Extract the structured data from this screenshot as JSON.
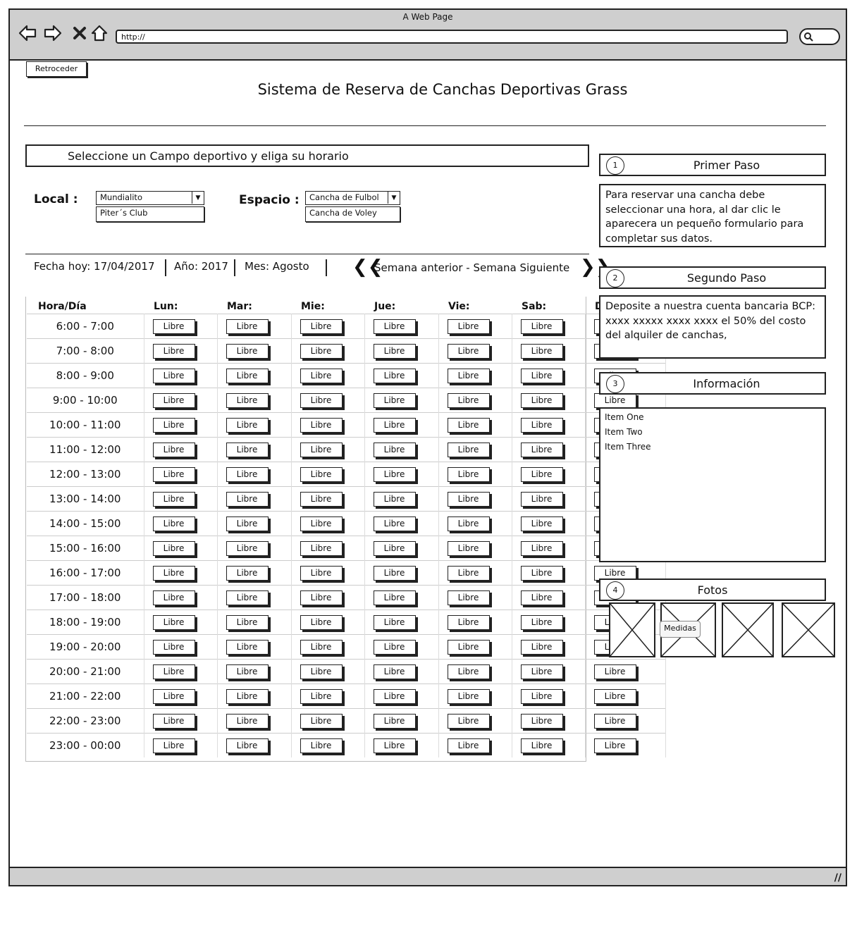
{
  "window": {
    "title": "A Web Page",
    "url": "http://"
  },
  "header": {
    "back_label": "Retroceder",
    "title": "Sistema de Reserva de Canchas Deportivas Grass"
  },
  "selector": {
    "heading": "Seleccione un Campo deportivo y eliga su horario",
    "local_label": "Local :",
    "local_selected": "Mundialito",
    "local_option": "Piter´s Club",
    "espacio_label": "Espacio :",
    "espacio_selected": "Cancha de Fulbol",
    "espacio_option": "Cancha de Voley"
  },
  "infobar": {
    "fecha": "Fecha hoy: 17/04/2017",
    "anio": "Año: 2017",
    "mes": "Mes: Agosto",
    "week_nav": "Semana anterior - Semana Siguiente"
  },
  "schedule": {
    "headers": [
      "Hora/Día",
      "Lun:",
      "Mar:",
      "Mie:",
      "Jue:",
      "Vie:",
      "Sab:",
      "Dom:"
    ],
    "slot_label": "Libre",
    "hours": [
      "6:00 - 7:00",
      "7:00 - 8:00",
      "8:00 - 9:00",
      "9:00 - 10:00",
      "10:00 - 11:00",
      "11:00 - 12:00",
      "12:00 - 13:00",
      "13:00 - 14:00",
      "14:00 - 15:00",
      "15:00 - 16:00",
      "16:00 - 17:00",
      "17:00 - 18:00",
      "18:00 - 19:00",
      "19:00 - 20:00",
      "20:00 - 21:00",
      "21:00 - 22:00",
      "22:00 - 23:00",
      "23:00 - 00:00"
    ]
  },
  "steps": [
    {
      "num": "1",
      "title": "Primer Paso",
      "body": "Para reservar una cancha debe seleccionar una hora, al dar clic le aparecera un pequeño formulario para completar sus datos."
    },
    {
      "num": "2",
      "title": "Segundo Paso",
      "body": "Deposite a nuestra cuenta bancaria BCP: xxxx xxxxx xxxx xxxx el 50% del costo del alquiler de canchas,"
    },
    {
      "num": "3",
      "title": "Información",
      "items": [
        "Item One",
        "Item Two",
        "Item Three"
      ]
    },
    {
      "num": "4",
      "title": "Fotos",
      "tooltip": "Medidas"
    }
  ]
}
